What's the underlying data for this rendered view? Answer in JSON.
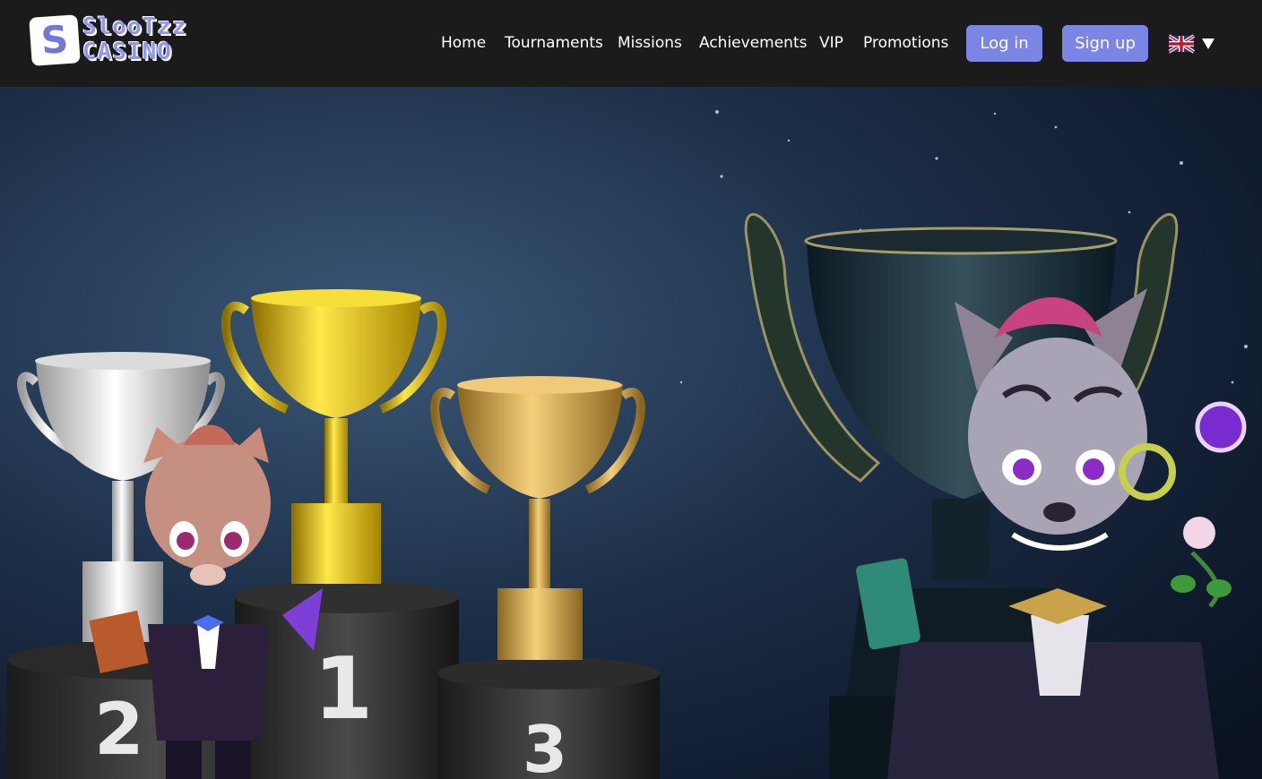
{
  "brand": {
    "logo_letter": "S",
    "logo_line1": "SlooTzz",
    "logo_line2": "CASINO",
    "accent": "#7b86e4"
  },
  "nav": {
    "items": [
      {
        "label": "Home"
      },
      {
        "label": "Tournaments"
      },
      {
        "label": "Missions"
      },
      {
        "label": "Achievements"
      },
      {
        "label": "VIP"
      },
      {
        "label": "Promotions"
      }
    ]
  },
  "auth": {
    "login_label": "Log in",
    "signup_label": "Sign up"
  },
  "language": {
    "flag_icon": "uk-flag-icon",
    "dropdown_icon": "triangle-down-icon"
  },
  "hero": {
    "podium_labels": [
      "2",
      "1",
      "3"
    ]
  }
}
